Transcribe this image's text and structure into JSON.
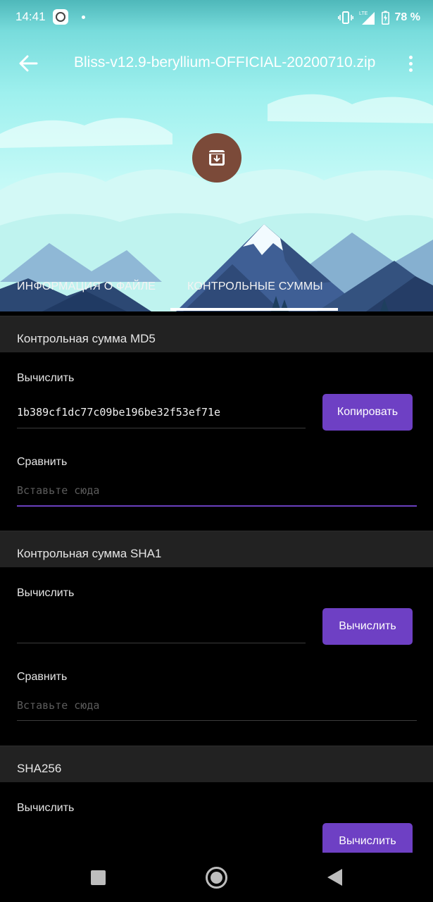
{
  "status_bar": {
    "time": "14:41",
    "network": "LTE",
    "battery": "78 %"
  },
  "app_bar": {
    "title": "Bliss-v12.9-beryllium-OFFICIAL-20200710.zip",
    "back_icon": "arrow-left-icon",
    "menu_icon": "more-vert-icon"
  },
  "file_icon": "archive-download-icon",
  "tabs": [
    {
      "label": "ИНФОРМАЦИЯ О ФАЙЛЕ",
      "selected": false
    },
    {
      "label": "КОНТРОЛЬНЫЕ СУММЫ",
      "selected": true
    }
  ],
  "sections": {
    "md5": {
      "title": "Контрольная сумма MD5",
      "calc_label": "Вычислить",
      "value": "1b389cf1dc77c09be196be32f53ef71e",
      "button": "Копировать",
      "compare_label": "Сравнить",
      "compare_placeholder": "Вставьте сюда"
    },
    "sha1": {
      "title": "Контрольная сумма SHA1",
      "calc_label": "Вычислить",
      "value": "",
      "button": "Вычислить",
      "compare_label": "Сравнить",
      "compare_placeholder": "Вставьте сюда"
    },
    "sha256": {
      "title": "SHA256",
      "calc_label": "Вычислить",
      "button": "Вычислить"
    }
  },
  "colors": {
    "accent": "#6e40c4",
    "section_header_bg": "#222222",
    "fab": "#7b4a39"
  }
}
